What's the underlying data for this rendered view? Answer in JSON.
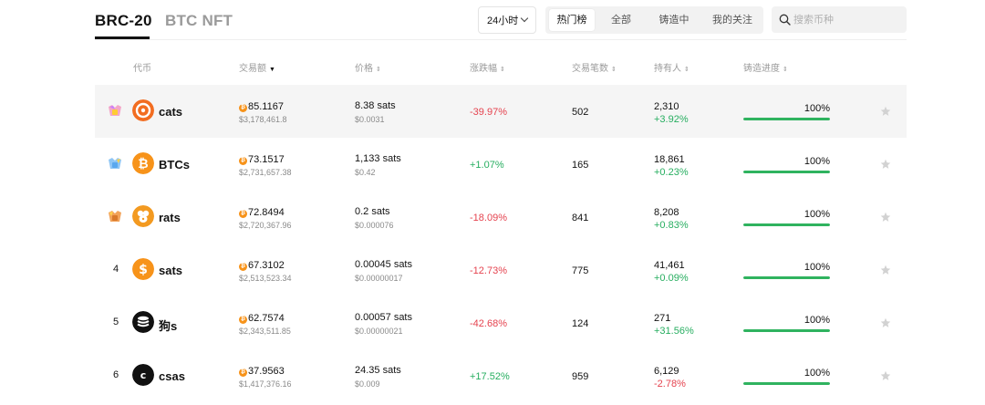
{
  "tabs": {
    "active": "BRC-20",
    "inactive": "BTC NFT"
  },
  "period_selector": {
    "label": "24小时"
  },
  "filters": [
    {
      "label": "热门榜",
      "active": true
    },
    {
      "label": "全部",
      "active": false
    },
    {
      "label": "铸造中",
      "active": false
    },
    {
      "label": "我的关注",
      "active": false
    }
  ],
  "search": {
    "placeholder": "搜索币种",
    "icon": "search-icon"
  },
  "columns": {
    "token": "代币",
    "volume": "交易额",
    "price": "价格",
    "change": "涨跌幅",
    "tx_count": "交易笔数",
    "holders": "持有人",
    "mint_progress": "铸造进度"
  },
  "sort_markers": {
    "desc": "▼",
    "both": "⇕"
  },
  "colors": {
    "negative": "#e5434f",
    "positive": "#27ae60",
    "progress": "#2fb35f",
    "btc": "#f7931a"
  },
  "rows": [
    {
      "rank": "1",
      "rank_badge": "gold-medal-icon",
      "name": "cats",
      "icon": "cats-logo-icon",
      "volume_btc": "85.1167",
      "volume_usd": "$3,178,461.8",
      "price": "8.38 sats",
      "price_usd": "$0.0031",
      "change": "-39.97%",
      "change_dir": "neg",
      "tx_count": "502",
      "holders": "2,310",
      "holders_change": "+3.92%",
      "holders_dir": "pos",
      "mint_progress": "100%",
      "mint_fraction": 1.0
    },
    {
      "rank": "2",
      "rank_badge": "silver-medal-icon",
      "name": "BTCs",
      "icon": "bitcoin-logo-icon",
      "volume_btc": "73.1517",
      "volume_usd": "$2,731,657.38",
      "price": "1,133 sats",
      "price_usd": "$0.42",
      "change": "+1.07%",
      "change_dir": "pos",
      "tx_count": "165",
      "holders": "18,861",
      "holders_change": "+0.23%",
      "holders_dir": "pos",
      "mint_progress": "100%",
      "mint_fraction": 1.0
    },
    {
      "rank": "3",
      "rank_badge": "bronze-medal-icon",
      "name": "rats",
      "icon": "rats-logo-icon",
      "volume_btc": "72.8494",
      "volume_usd": "$2,720,367.96",
      "price": "0.2 sats",
      "price_usd": "$0.000076",
      "change": "-18.09%",
      "change_dir": "neg",
      "tx_count": "841",
      "holders": "8,208",
      "holders_change": "+0.83%",
      "holders_dir": "pos",
      "mint_progress": "100%",
      "mint_fraction": 1.0
    },
    {
      "rank": "4",
      "rank_badge": "",
      "name": "sats",
      "icon": "sats-logo-icon",
      "volume_btc": "67.3102",
      "volume_usd": "$2,513,523.34",
      "price": "0.00045 sats",
      "price_usd": "$0.00000017",
      "change": "-12.73%",
      "change_dir": "neg",
      "tx_count": "775",
      "holders": "41,461",
      "holders_change": "+0.09%",
      "holders_dir": "pos",
      "mint_progress": "100%",
      "mint_fraction": 1.0
    },
    {
      "rank": "5",
      "rank_badge": "",
      "name": "狗s",
      "icon": "stack-logo-icon",
      "volume_btc": "62.7574",
      "volume_usd": "$2,343,511.85",
      "price": "0.00057 sats",
      "price_usd": "$0.00000021",
      "change": "-42.68%",
      "change_dir": "neg",
      "tx_count": "124",
      "holders": "271",
      "holders_change": "+31.56%",
      "holders_dir": "pos",
      "mint_progress": "100%",
      "mint_fraction": 1.0
    },
    {
      "rank": "6",
      "rank_badge": "",
      "name": "csas",
      "icon": "letter-c-logo-icon",
      "volume_btc": "37.9563",
      "volume_usd": "$1,417,376.16",
      "price": "24.35 sats",
      "price_usd": "$0.009",
      "change": "+17.52%",
      "change_dir": "pos",
      "tx_count": "959",
      "holders": "6,129",
      "holders_change": "-2.78%",
      "holders_dir": "neg",
      "mint_progress": "100%",
      "mint_fraction": 1.0
    }
  ]
}
